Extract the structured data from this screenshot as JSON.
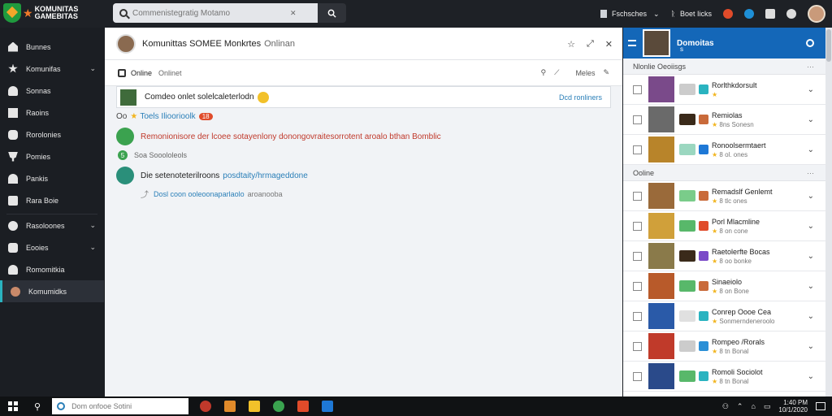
{
  "app": {
    "logo_line1": "KOMUNITAS",
    "logo_line2": "GAMEBITAS"
  },
  "search": {
    "placeholder": "Commenistegratig Motamo"
  },
  "topbar": {
    "user_label": "Fschsches",
    "games_label": "Boet Iicks"
  },
  "sidebar": {
    "items": [
      {
        "label": "Bunnes"
      },
      {
        "label": "Komunifas"
      },
      {
        "label": "Sonnas"
      },
      {
        "label": "Raoins"
      },
      {
        "label": "Rorolonies"
      },
      {
        "label": "Pomies"
      },
      {
        "label": "Pankis"
      },
      {
        "label": "Rara Boie"
      },
      {
        "label": "Rasoloones"
      },
      {
        "label": "Eooies"
      },
      {
        "label": "Romomitkia"
      },
      {
        "label": "Komumidks"
      }
    ]
  },
  "header": {
    "title": "Komunittas SOMEE Monkrtes",
    "subtitle": "Onlinan"
  },
  "tabs": {
    "tab1": "Online",
    "tab2": "Onlinet",
    "right_label": "Meles"
  },
  "banner": {
    "text": "Comdeo onlet solelcaleterlodn",
    "link": "Dcd ronliners"
  },
  "feed": {
    "meta_prefix": "Oo",
    "meta_name": "Toels Ilioorioolk",
    "meta_tag": "18",
    "msg1": "Remonionisore der lcoee sotayenlony donongovraitesorrotent aroalo bthan Bomblic",
    "sub_count": "5",
    "sub_label": "Soa Sooololeols",
    "msg2_text": "Die setenoteterilroons",
    "msg2_link": "posdtaity/hrmageddone",
    "reply_link": "Dosl coon ooleoonaparlaolo",
    "reply_extra": "aroanooba"
  },
  "right_panel": {
    "title": "Domoitas",
    "subtitle": "s",
    "section1": "Nlonlie Oeoiisgs",
    "section2": "Ooline",
    "group1": [
      {
        "name": "Rorlthkdorsult",
        "meta": ""
      },
      {
        "name": "Remiolas",
        "meta": "8ns Sonesn"
      },
      {
        "name": "Ronoolsermtaert",
        "meta": "8 ol. ones"
      }
    ],
    "group2": [
      {
        "name": "Remadslf Genlemt",
        "meta": "8 tlc ones"
      },
      {
        "name": "Porl Mlacmline",
        "meta": "8 on cone"
      },
      {
        "name": "Raetolerfte Bocas",
        "meta": "8 oo bonke"
      },
      {
        "name": "Sinaeiolo",
        "meta": "8 on Bone"
      },
      {
        "name": "Conrep Oooe Cea",
        "meta": "Sonmerndeneroolo"
      },
      {
        "name": "Rompeo /Rorals",
        "meta": "8 tn Bonal"
      },
      {
        "name": "Romoli Sociolot",
        "meta": "8 tn Bonal"
      }
    ]
  },
  "taskbar": {
    "search_placeholder": "Dom onfooe Sotini",
    "time": "1:40 PM",
    "date": "10/1/2020"
  },
  "colors": {
    "accent": "#1467b8",
    "sidebar_bg": "#1b1e23",
    "active_indicator": "#2ab3c0"
  }
}
